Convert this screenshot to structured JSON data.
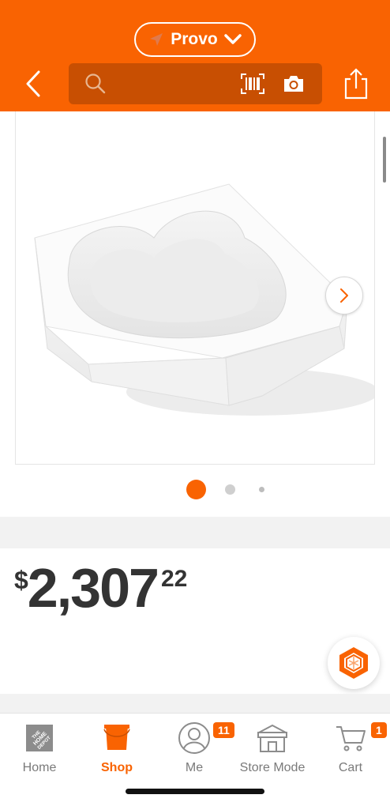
{
  "header": {
    "store_name": "Provo",
    "search_placeholder": "",
    "icons": [
      "location-arrow-icon",
      "chevron-down-icon",
      "back-icon",
      "search-icon",
      "barcode-icon",
      "camera-icon",
      "share-icon"
    ]
  },
  "gallery": {
    "image_alt": "white corner bathtub",
    "image_count": 3,
    "active_index": 0
  },
  "price": {
    "currency": "$",
    "dollars": "2,307",
    "cents": "22"
  },
  "tabs": [
    {
      "label": "Home",
      "icon": "home-depot-logo-icon",
      "active": false
    },
    {
      "label": "Shop",
      "icon": "shop-bucket-icon",
      "active": true
    },
    {
      "label": "Me",
      "icon": "person-icon",
      "active": false,
      "badge": "11"
    },
    {
      "label": "Store Mode",
      "icon": "store-icon",
      "active": false
    },
    {
      "label": "Cart",
      "icon": "cart-icon",
      "active": false,
      "badge": "1"
    }
  ],
  "colors": {
    "brand": "#f96302",
    "search_bg": "#c84f02",
    "text_dark": "#333333",
    "tab_inactive": "#7a7a7a"
  }
}
